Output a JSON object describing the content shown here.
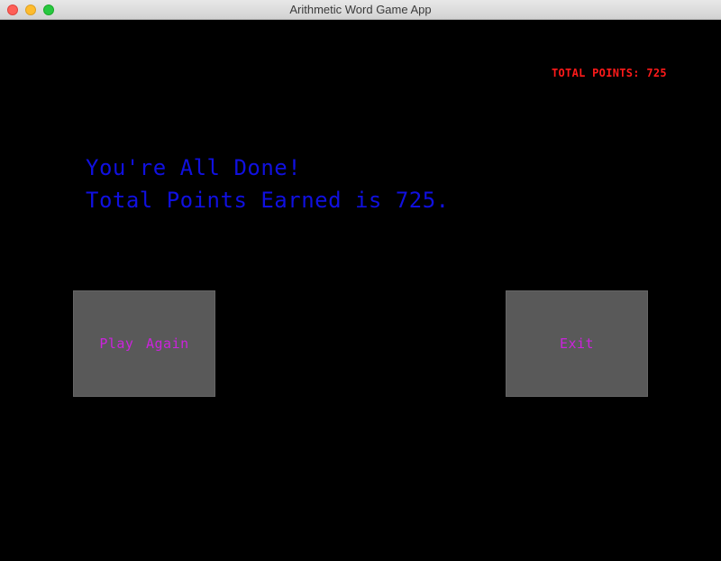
{
  "window": {
    "title": "Arithmetic Word Game App"
  },
  "score": {
    "label": "TOTAL POINTS: 725"
  },
  "message": {
    "line1": "You're All Done!",
    "line2": "Total Points Earned is 725."
  },
  "buttons": {
    "play_again": "Play Again",
    "exit": "Exit"
  },
  "colors": {
    "background": "#000000",
    "score_text": "#ff1a1a",
    "message_text": "#1010e0",
    "button_bg": "#595959",
    "button_text": "#cc22dd"
  }
}
